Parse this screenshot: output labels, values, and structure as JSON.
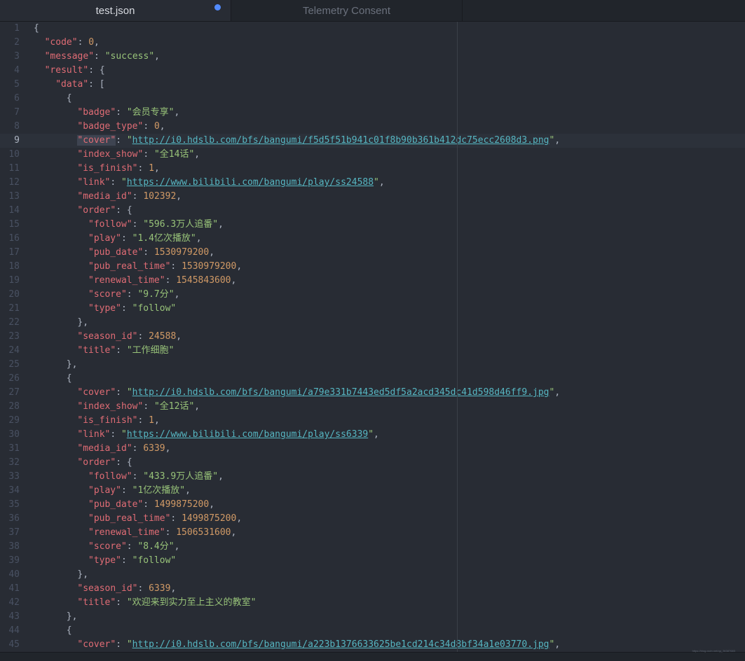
{
  "tabs": [
    {
      "title": "test.json",
      "active": true,
      "modified": true
    },
    {
      "title": "Telemetry Consent",
      "active": false,
      "modified": false
    }
  ],
  "colors": {
    "key": "#e06c75",
    "string": "#98c379",
    "number": "#d19a66",
    "url": "#56b6c2",
    "modified_dot": "#528bff"
  },
  "cursor_line": 9,
  "watermark": "https://blog.csdn.net/qq_36387683",
  "lines": [
    {
      "n": "1",
      "indent": 0,
      "tokens": [
        [
          "punc",
          "{"
        ]
      ]
    },
    {
      "n": "2",
      "indent": 2,
      "tokens": [
        [
          "key",
          "\"code\""
        ],
        [
          "punc",
          ": "
        ],
        [
          "num",
          "0"
        ],
        [
          "punc",
          ","
        ]
      ]
    },
    {
      "n": "3",
      "indent": 2,
      "tokens": [
        [
          "key",
          "\"message\""
        ],
        [
          "punc",
          ": "
        ],
        [
          "str",
          "\"success\""
        ],
        [
          "punc",
          ","
        ]
      ]
    },
    {
      "n": "4",
      "indent": 2,
      "tokens": [
        [
          "key",
          "\"result\""
        ],
        [
          "punc",
          ": {"
        ]
      ]
    },
    {
      "n": "5",
      "indent": 4,
      "tokens": [
        [
          "key",
          "\"data\""
        ],
        [
          "punc",
          ": ["
        ]
      ]
    },
    {
      "n": "6",
      "indent": 6,
      "tokens": [
        [
          "punc",
          "{"
        ]
      ]
    },
    {
      "n": "7",
      "indent": 8,
      "tokens": [
        [
          "key",
          "\"badge\""
        ],
        [
          "punc",
          ": "
        ],
        [
          "str",
          "\"会员专享\""
        ],
        [
          "punc",
          ","
        ]
      ]
    },
    {
      "n": "8",
      "indent": 8,
      "tokens": [
        [
          "key",
          "\"badge_type\""
        ],
        [
          "punc",
          ": "
        ],
        [
          "num",
          "0"
        ],
        [
          "punc",
          ","
        ]
      ]
    },
    {
      "n": "9",
      "indent": 8,
      "tokens": [
        [
          "sel",
          "\"cover\""
        ],
        [
          "punc",
          ": "
        ],
        [
          "str",
          "\""
        ],
        [
          "url",
          "http://i0.hdslb.com/bfs/bangumi/f5d5f51b941c01f8b90b361b412dc75ecc2608d3.png"
        ],
        [
          "str",
          "\""
        ],
        [
          "punc",
          ","
        ]
      ]
    },
    {
      "n": "10",
      "indent": 8,
      "tokens": [
        [
          "key",
          "\"index_show\""
        ],
        [
          "punc",
          ": "
        ],
        [
          "str",
          "\"全14话\""
        ],
        [
          "punc",
          ","
        ]
      ]
    },
    {
      "n": "11",
      "indent": 8,
      "tokens": [
        [
          "key",
          "\"is_finish\""
        ],
        [
          "punc",
          ": "
        ],
        [
          "num",
          "1"
        ],
        [
          "punc",
          ","
        ]
      ]
    },
    {
      "n": "12",
      "indent": 8,
      "tokens": [
        [
          "key",
          "\"link\""
        ],
        [
          "punc",
          ": "
        ],
        [
          "str",
          "\""
        ],
        [
          "url",
          "https://www.bilibili.com/bangumi/play/ss24588"
        ],
        [
          "str",
          "\""
        ],
        [
          "punc",
          ","
        ]
      ]
    },
    {
      "n": "13",
      "indent": 8,
      "tokens": [
        [
          "key",
          "\"media_id\""
        ],
        [
          "punc",
          ": "
        ],
        [
          "num",
          "102392"
        ],
        [
          "punc",
          ","
        ]
      ]
    },
    {
      "n": "14",
      "indent": 8,
      "tokens": [
        [
          "key",
          "\"order\""
        ],
        [
          "punc",
          ": {"
        ]
      ]
    },
    {
      "n": "15",
      "indent": 10,
      "tokens": [
        [
          "key",
          "\"follow\""
        ],
        [
          "punc",
          ": "
        ],
        [
          "str",
          "\"596.3万人追番\""
        ],
        [
          "punc",
          ","
        ]
      ]
    },
    {
      "n": "16",
      "indent": 10,
      "tokens": [
        [
          "key",
          "\"play\""
        ],
        [
          "punc",
          ": "
        ],
        [
          "str",
          "\"1.4亿次播放\""
        ],
        [
          "punc",
          ","
        ]
      ]
    },
    {
      "n": "17",
      "indent": 10,
      "tokens": [
        [
          "key",
          "\"pub_date\""
        ],
        [
          "punc",
          ": "
        ],
        [
          "num",
          "1530979200"
        ],
        [
          "punc",
          ","
        ]
      ]
    },
    {
      "n": "18",
      "indent": 10,
      "tokens": [
        [
          "key",
          "\"pub_real_time\""
        ],
        [
          "punc",
          ": "
        ],
        [
          "num",
          "1530979200"
        ],
        [
          "punc",
          ","
        ]
      ]
    },
    {
      "n": "19",
      "indent": 10,
      "tokens": [
        [
          "key",
          "\"renewal_time\""
        ],
        [
          "punc",
          ": "
        ],
        [
          "num",
          "1545843600"
        ],
        [
          "punc",
          ","
        ]
      ]
    },
    {
      "n": "20",
      "indent": 10,
      "tokens": [
        [
          "key",
          "\"score\""
        ],
        [
          "punc",
          ": "
        ],
        [
          "str",
          "\"9.7分\""
        ],
        [
          "punc",
          ","
        ]
      ]
    },
    {
      "n": "21",
      "indent": 10,
      "tokens": [
        [
          "key",
          "\"type\""
        ],
        [
          "punc",
          ": "
        ],
        [
          "str",
          "\"follow\""
        ]
      ]
    },
    {
      "n": "22",
      "indent": 8,
      "tokens": [
        [
          "punc",
          "},"
        ]
      ]
    },
    {
      "n": "23",
      "indent": 8,
      "tokens": [
        [
          "key",
          "\"season_id\""
        ],
        [
          "punc",
          ": "
        ],
        [
          "num",
          "24588"
        ],
        [
          "punc",
          ","
        ]
      ]
    },
    {
      "n": "24",
      "indent": 8,
      "tokens": [
        [
          "key",
          "\"title\""
        ],
        [
          "punc",
          ": "
        ],
        [
          "str",
          "\"工作细胞\""
        ]
      ]
    },
    {
      "n": "25",
      "indent": 6,
      "tokens": [
        [
          "punc",
          "},"
        ]
      ]
    },
    {
      "n": "26",
      "indent": 6,
      "tokens": [
        [
          "punc",
          "{"
        ]
      ]
    },
    {
      "n": "27",
      "indent": 8,
      "tokens": [
        [
          "key",
          "\"cover\""
        ],
        [
          "punc",
          ": "
        ],
        [
          "str",
          "\""
        ],
        [
          "url",
          "http://i0.hdslb.com/bfs/bangumi/a79e331b7443ed5df5a2acd345dc41d598d46ff9.jpg"
        ],
        [
          "str",
          "\""
        ],
        [
          "punc",
          ","
        ]
      ]
    },
    {
      "n": "28",
      "indent": 8,
      "tokens": [
        [
          "key",
          "\"index_show\""
        ],
        [
          "punc",
          ": "
        ],
        [
          "str",
          "\"全12话\""
        ],
        [
          "punc",
          ","
        ]
      ]
    },
    {
      "n": "29",
      "indent": 8,
      "tokens": [
        [
          "key",
          "\"is_finish\""
        ],
        [
          "punc",
          ": "
        ],
        [
          "num",
          "1"
        ],
        [
          "punc",
          ","
        ]
      ]
    },
    {
      "n": "30",
      "indent": 8,
      "tokens": [
        [
          "key",
          "\"link\""
        ],
        [
          "punc",
          ": "
        ],
        [
          "str",
          "\""
        ],
        [
          "url",
          "https://www.bilibili.com/bangumi/play/ss6339"
        ],
        [
          "str",
          "\""
        ],
        [
          "punc",
          ","
        ]
      ]
    },
    {
      "n": "31",
      "indent": 8,
      "tokens": [
        [
          "key",
          "\"media_id\""
        ],
        [
          "punc",
          ": "
        ],
        [
          "num",
          "6339"
        ],
        [
          "punc",
          ","
        ]
      ]
    },
    {
      "n": "32",
      "indent": 8,
      "tokens": [
        [
          "key",
          "\"order\""
        ],
        [
          "punc",
          ": {"
        ]
      ]
    },
    {
      "n": "33",
      "indent": 10,
      "tokens": [
        [
          "key",
          "\"follow\""
        ],
        [
          "punc",
          ": "
        ],
        [
          "str",
          "\"433.9万人追番\""
        ],
        [
          "punc",
          ","
        ]
      ]
    },
    {
      "n": "34",
      "indent": 10,
      "tokens": [
        [
          "key",
          "\"play\""
        ],
        [
          "punc",
          ": "
        ],
        [
          "str",
          "\"1亿次播放\""
        ],
        [
          "punc",
          ","
        ]
      ]
    },
    {
      "n": "35",
      "indent": 10,
      "tokens": [
        [
          "key",
          "\"pub_date\""
        ],
        [
          "punc",
          ": "
        ],
        [
          "num",
          "1499875200"
        ],
        [
          "punc",
          ","
        ]
      ]
    },
    {
      "n": "36",
      "indent": 10,
      "tokens": [
        [
          "key",
          "\"pub_real_time\""
        ],
        [
          "punc",
          ": "
        ],
        [
          "num",
          "1499875200"
        ],
        [
          "punc",
          ","
        ]
      ]
    },
    {
      "n": "37",
      "indent": 10,
      "tokens": [
        [
          "key",
          "\"renewal_time\""
        ],
        [
          "punc",
          ": "
        ],
        [
          "num",
          "1506531600"
        ],
        [
          "punc",
          ","
        ]
      ]
    },
    {
      "n": "38",
      "indent": 10,
      "tokens": [
        [
          "key",
          "\"score\""
        ],
        [
          "punc",
          ": "
        ],
        [
          "str",
          "\"8.4分\""
        ],
        [
          "punc",
          ","
        ]
      ]
    },
    {
      "n": "39",
      "indent": 10,
      "tokens": [
        [
          "key",
          "\"type\""
        ],
        [
          "punc",
          ": "
        ],
        [
          "str",
          "\"follow\""
        ]
      ]
    },
    {
      "n": "40",
      "indent": 8,
      "tokens": [
        [
          "punc",
          "},"
        ]
      ]
    },
    {
      "n": "41",
      "indent": 8,
      "tokens": [
        [
          "key",
          "\"season_id\""
        ],
        [
          "punc",
          ": "
        ],
        [
          "num",
          "6339"
        ],
        [
          "punc",
          ","
        ]
      ]
    },
    {
      "n": "42",
      "indent": 8,
      "tokens": [
        [
          "key",
          "\"title\""
        ],
        [
          "punc",
          ": "
        ],
        [
          "str",
          "\"欢迎来到实力至上主义的教室\""
        ]
      ]
    },
    {
      "n": "43",
      "indent": 6,
      "tokens": [
        [
          "punc",
          "},"
        ]
      ]
    },
    {
      "n": "44",
      "indent": 6,
      "tokens": [
        [
          "punc",
          "{"
        ]
      ]
    },
    {
      "n": "45",
      "indent": 8,
      "tokens": [
        [
          "key",
          "\"cover\""
        ],
        [
          "punc",
          ": "
        ],
        [
          "str",
          "\""
        ],
        [
          "url",
          "http://i0.hdslb.com/bfs/bangumi/a223b1376633625be1cd214c34d8bf34a1e03770.jpg"
        ],
        [
          "str",
          "\""
        ],
        [
          "punc",
          ","
        ]
      ]
    }
  ]
}
